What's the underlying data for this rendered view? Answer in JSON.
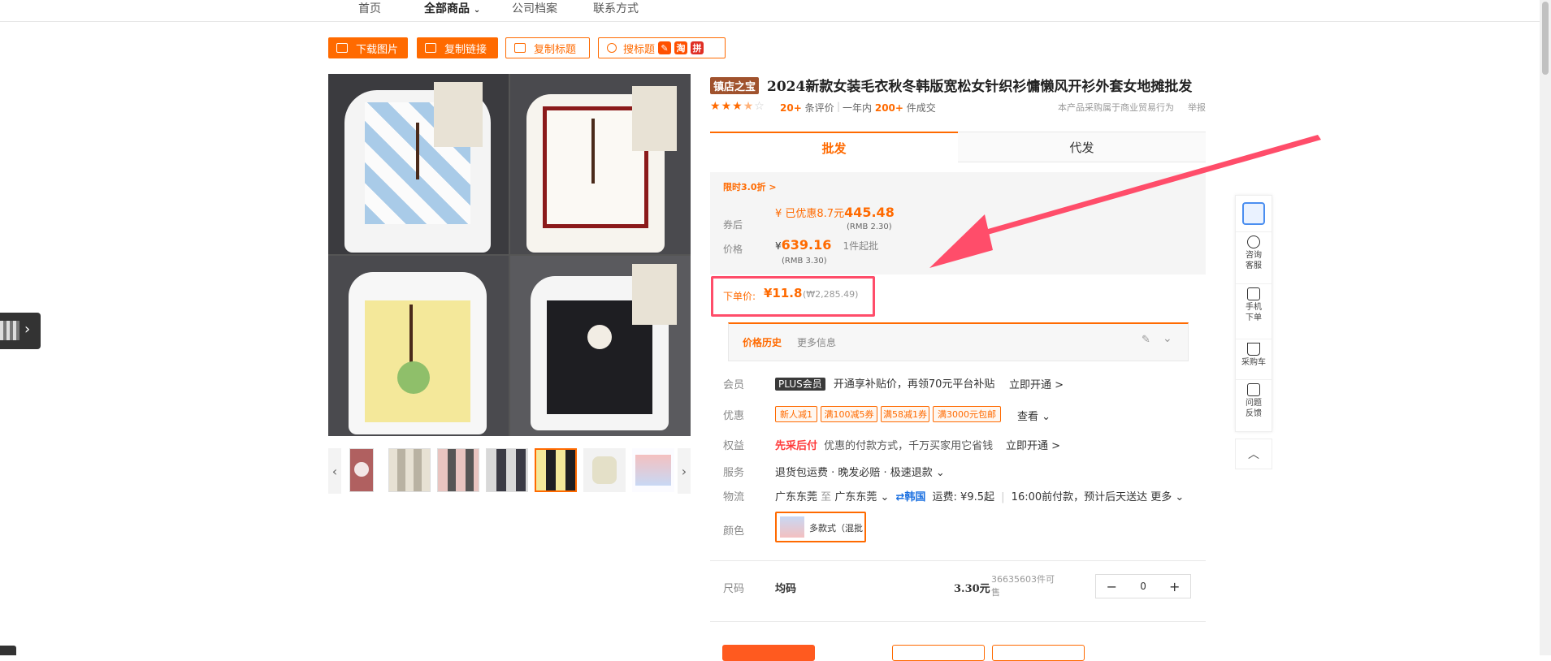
{
  "nav": {
    "items": [
      "首页",
      "全部商品",
      "公司档案",
      "联系方式"
    ]
  },
  "toolbar": {
    "download_images": "下载图片",
    "copy_link": "复制链接",
    "copy_title": "复制标题",
    "search_title": "搜标题",
    "badge_taobao": "淘",
    "badge_pdd": "拼"
  },
  "product": {
    "store_badge": "镇店之宝",
    "title": "2024新款女装毛衣秋冬韩版宽松女针织衫慵懒风开衫外套女地摊批发",
    "rating": 3.5,
    "reviews_count": "20+",
    "reviews_label": "条评价",
    "year_label": "一年内",
    "sold_count": "200+",
    "sold_label": "件成交",
    "business_note": "本产品采购属于商业贸易行为",
    "report": "举报"
  },
  "tabs": [
    "批发",
    "代发"
  ],
  "pricing": {
    "flash_sale": "限时3.0折 >",
    "after_coupon_label": "券后",
    "after_coupon_prefix": "¥   已优惠8.7元",
    "after_coupon_value": "445.48",
    "after_coupon_rmb": "(RMB 2.30)",
    "price_label": "价格",
    "price_currency": "¥",
    "price_value": "639.16",
    "min_order": "1件起批",
    "price_rmb": "(RMB 3.30)"
  },
  "order_price": {
    "label": "下单价:",
    "value": "¥11.8",
    "krw": "(₩2,285.49)"
  },
  "history": {
    "tab_active": "价格历史",
    "tab_more": "更多信息"
  },
  "rows": {
    "member_label": "会员",
    "plus_badge": "PLUS会员",
    "member_text": "开通享补贴价，再领70元平台补贴",
    "member_action": "立即开通 >",
    "discount_label": "优惠",
    "coupons": [
      "新人减1",
      "满100减5券",
      "满58减1券",
      "满3000元包邮"
    ],
    "discount_action": "查看 ⌄",
    "rights_label": "权益",
    "rights_highlight": "先采后付",
    "rights_text": "优惠的付款方式，千万买家用它省钱",
    "rights_action": "立即开通 >",
    "service_label": "服务",
    "service_text": "退货包运费 · 晚发必赔 · 极速退款 ⌄",
    "logistics_label": "物流",
    "logistics_from": "广东东莞",
    "logistics_to_word": "至",
    "logistics_to": "广东东莞 ⌄",
    "logistics_korea": "⇄韩国",
    "logistics_fee": "运费: ¥9.5起",
    "logistics_time": "16:00前付款，预计后天送达 更多 ⌄",
    "color_label": "颜色",
    "color_option": "多款式（混批"
  },
  "size_row": {
    "label": "尺码",
    "size": "均码",
    "price": "3.30元",
    "stock": "36635603件可售",
    "qty": "0",
    "minus": "−",
    "plus": "+"
  },
  "side_tools": {
    "consult": "咨询客服",
    "mobile": "手机下单",
    "cart": "采购车",
    "feedback": "问题反馈"
  },
  "colors": {
    "accent": "#ff6a00",
    "highlight_box": "#ff4d6a",
    "arrow": "#ff4d6a",
    "store_badge": "#a0522d"
  }
}
